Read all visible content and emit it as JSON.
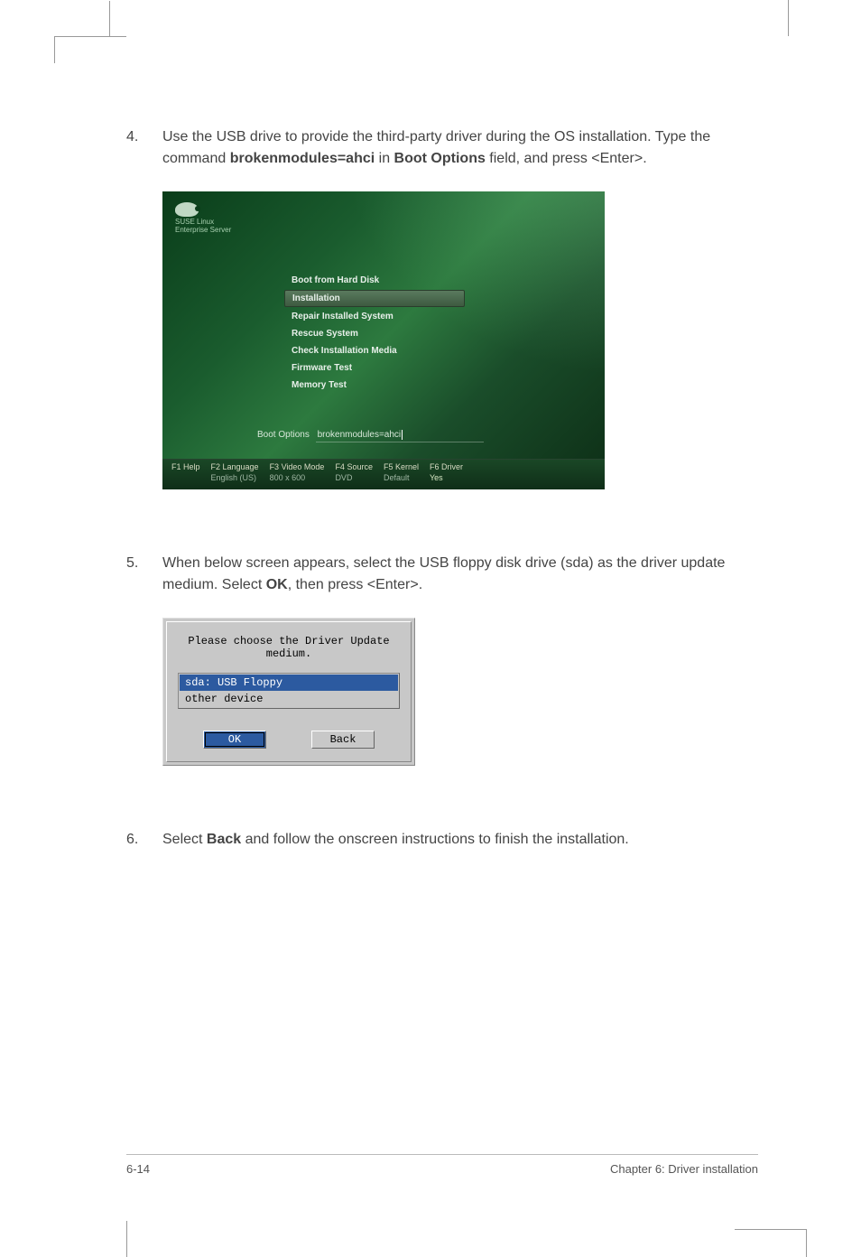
{
  "steps": {
    "s4": {
      "num": "4.",
      "pre": "Use the USB drive to provide the third-party driver during the OS installation. Type the command ",
      "cmd": "brokenmodules=ahci",
      "mid": " in ",
      "field": "Boot Options",
      "post": " field, and press <Enter>."
    },
    "s5": {
      "num": "5.",
      "pre": "When below screen appears, select the USB floppy disk drive (sda) as the driver update medium. Select ",
      "ok": "OK",
      "post": ", then press <Enter>."
    },
    "s6": {
      "num": "6.",
      "pre": "Select ",
      "back": "Back",
      "post": " and follow the onscreen instructions to finish the installation."
    }
  },
  "suse": {
    "logo_line1": "SUSE Linux",
    "logo_line2": "Enterprise Server",
    "menu": {
      "m0": "Boot from Hard Disk",
      "m1": "Installation",
      "m2": "Repair Installed System",
      "m3": "Rescue System",
      "m4": "Check Installation Media",
      "m5": "Firmware Test",
      "m6": "Memory Test"
    },
    "boot_options_label": "Boot Options",
    "boot_options_value": "brokenmodules=ahci",
    "footer": {
      "f1": "F1 Help",
      "f2": "F2 Language",
      "f2v": "English (US)",
      "f3": "F3 Video Mode",
      "f3v": "800 x 600",
      "f4": "F4 Source",
      "f4v": "DVD",
      "f5": "F5 Kernel",
      "f5v": "Default",
      "f6": "F6 Driver",
      "f6v": "Yes"
    }
  },
  "dialog": {
    "title": "Please choose the Driver Update medium.",
    "items": {
      "i0": "sda: USB Floppy",
      "i1": "other device"
    },
    "ok": "OK",
    "back": "Back"
  },
  "footer": {
    "page": "6-14",
    "chapter": "Chapter 6: Driver installation"
  }
}
